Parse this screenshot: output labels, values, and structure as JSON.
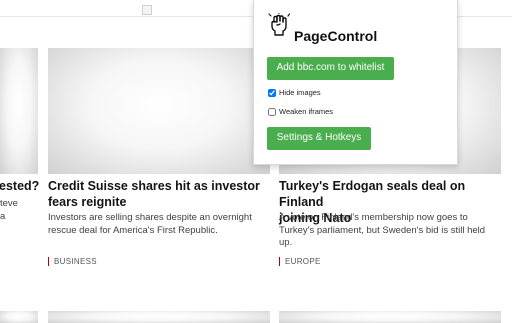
{
  "popup": {
    "title": "PageControl",
    "icon": "raised-fist-icon",
    "whitelist_button_label": "Add bbc.com to whitelist",
    "options": [
      {
        "label": "Hide images",
        "checked": true
      },
      {
        "label": "Weaken iframes",
        "checked": false
      }
    ],
    "settings_button_label": "Settings & Hotkeys",
    "accent_color": "#4aae4e"
  },
  "articles": [
    {
      "headline": "ested?",
      "summary_lines": [
        "teve",
        "a"
      ],
      "tag": ""
    },
    {
      "headline_lines": [
        "Credit Suisse shares hit as investor",
        "fears reignite"
      ],
      "summary_lines": [
        "Investors are selling shares despite an overnight",
        "rescue deal for America's First Republic."
      ],
      "tag": "BUSINESS"
    },
    {
      "headline_lines": [
        "Turkey's Erdogan seals deal on Finland",
        "joining Nato"
      ],
      "summary_lines": [
        "A vote on Finland's membership now goes to",
        "Turkey's parliament, but Sweden's bid is still held",
        "up."
      ],
      "tag": "EUROPE"
    }
  ],
  "tag_color": "#b80000"
}
